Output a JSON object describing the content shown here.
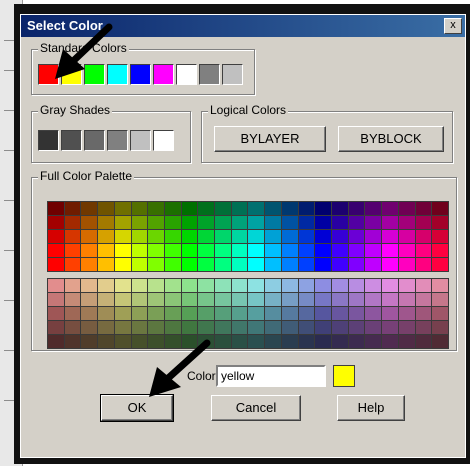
{
  "dialog": {
    "title": "Select Color",
    "close_label": "x"
  },
  "standard": {
    "label": "Standard Colors",
    "colors": [
      "#ff0000",
      "#ffff00",
      "#00ff00",
      "#00ffff",
      "#0000ff",
      "#ff00ff",
      "#ffffff",
      "#808080",
      "#c0c0c0"
    ]
  },
  "gray": {
    "label": "Gray Shades",
    "colors": [
      "#333333",
      "#505050",
      "#696969",
      "#808080",
      "#c0c0c0",
      "#ffffff"
    ]
  },
  "logical": {
    "label": "Logical Colors",
    "bylayer": "BYLAYER",
    "byblock": "BYBLOCK"
  },
  "palette": {
    "label": "Full Color Palette"
  },
  "color_field": {
    "label": "Color:",
    "value": "yellow",
    "preview": "#ffff00"
  },
  "buttons": {
    "ok": "OK",
    "cancel": "Cancel",
    "help": "Help"
  }
}
